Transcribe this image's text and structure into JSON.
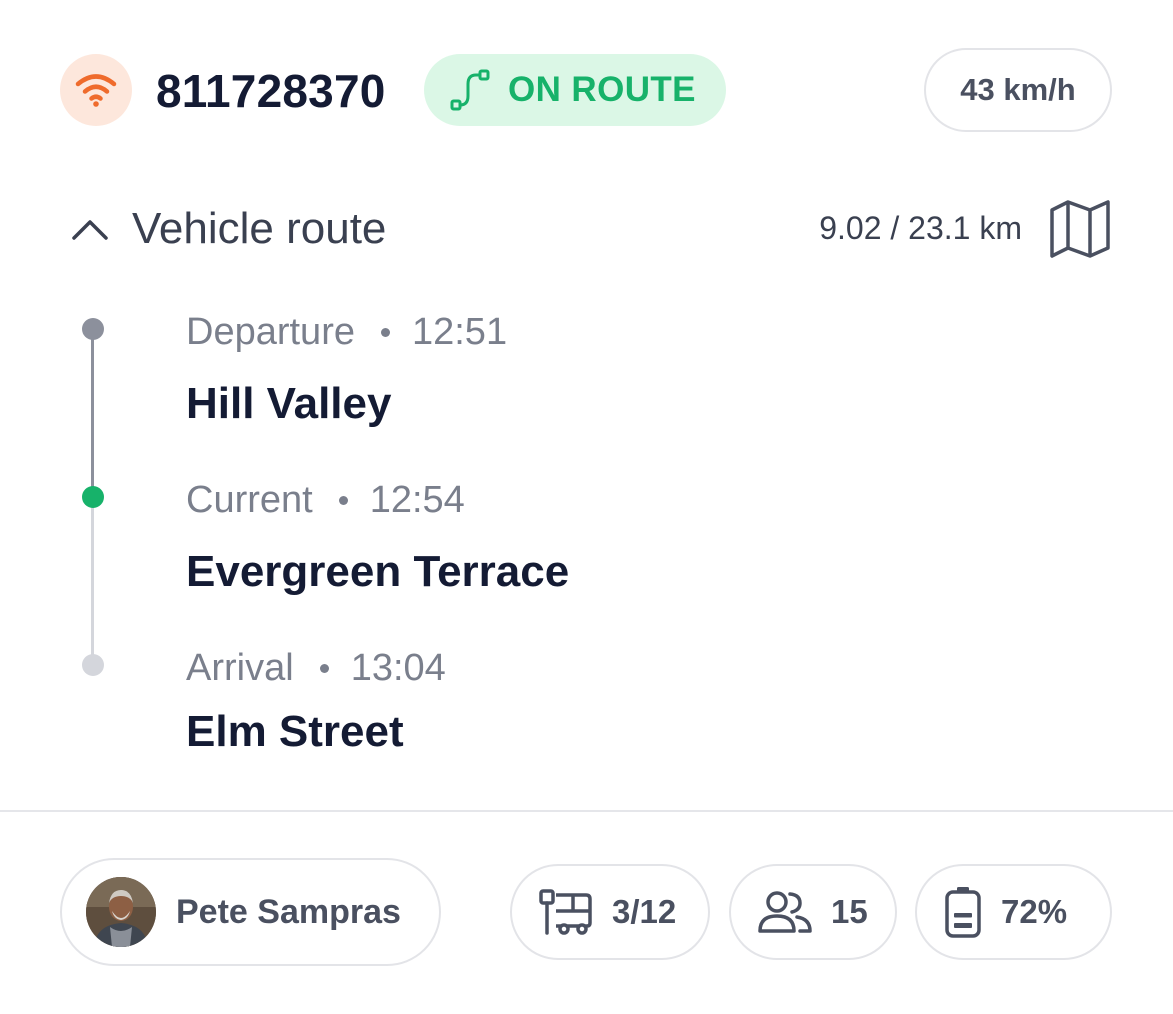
{
  "header": {
    "signal_icon": "wifi-signal-icon",
    "signal_color": "#ef6b2c",
    "vehicle_id": "811728370",
    "status": {
      "icon": "route-icon",
      "label": "ON ROUTE",
      "color": "#17b26a"
    },
    "speed": "43 km/h"
  },
  "route": {
    "toggle_icon": "chevron-up-icon",
    "title": "Vehicle route",
    "distance": "9.02 / 23.1 km",
    "map_icon": "map-icon",
    "stops": [
      {
        "type": "Departure",
        "time": "12:51",
        "name": "Hill Valley",
        "dot_color": "#8c909c"
      },
      {
        "type": "Current",
        "time": "12:54",
        "name": "Evergreen Terrace",
        "dot_color": "#17b26a"
      },
      {
        "type": "Arrival",
        "time": "13:04",
        "name": "Elm Street",
        "dot_color": "#d4d6dc"
      }
    ]
  },
  "footer": {
    "driver": {
      "name": "Pete Sampras",
      "avatar": "driver-avatar"
    },
    "stops_count": {
      "icon": "bus-stop-icon",
      "value": "3/12"
    },
    "passengers": {
      "icon": "users-icon",
      "value": "15"
    },
    "battery": {
      "icon": "battery-icon",
      "value": "72%",
      "level": 0.72
    }
  }
}
